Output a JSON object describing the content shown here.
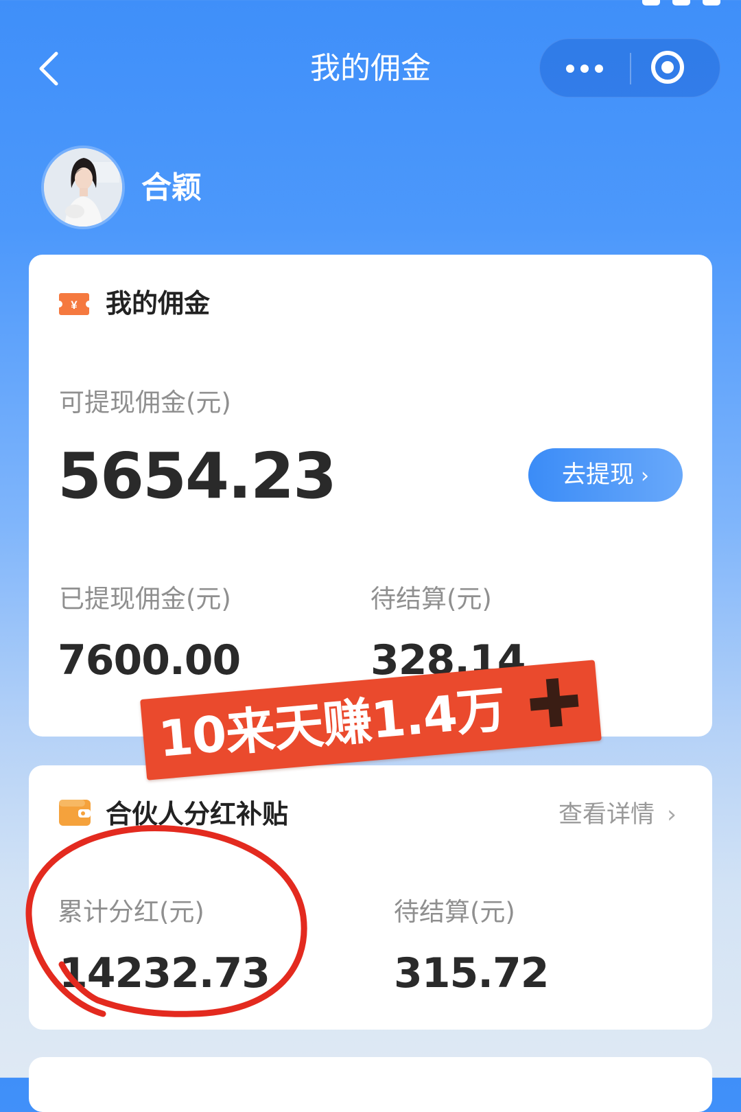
{
  "nav": {
    "title": "我的佣金",
    "back_icon": "chevron-left-icon",
    "more_icon": "more-dots-icon",
    "close_icon": "target-icon"
  },
  "profile": {
    "name": "合颖"
  },
  "commission": {
    "title": "我的佣金",
    "icon": "ticket-yuan-icon",
    "withdrawable_label": "可提现佣金(元)",
    "withdrawable_value": "5654.23",
    "withdraw_button": "去提现",
    "withdrawn_label": "已提现佣金(元)",
    "withdrawn_value": "7600.00",
    "pending_label": "待结算(元)",
    "pending_value": "328.14"
  },
  "promo": {
    "text": "10来天赚1.4万"
  },
  "partner": {
    "title": "合伙人分红补贴",
    "icon": "wallet-icon",
    "view_detail": "查看详情",
    "total_label": "累计分红(元)",
    "total_value": "14232.73",
    "pending_label": "待结算(元)",
    "pending_value": "315.72"
  },
  "colors": {
    "header_blue": "#3f8ff9",
    "accent_orange": "#f5793f",
    "promo_red": "#ea4a2d",
    "annotation_red": "#e32a1f",
    "button_blue": "#3b8cf7"
  }
}
